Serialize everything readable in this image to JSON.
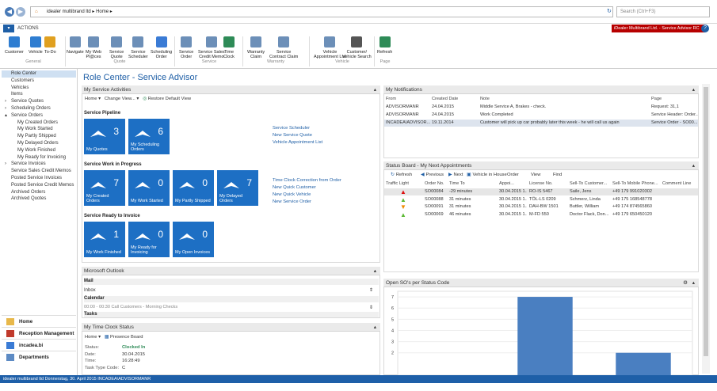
{
  "address": {
    "company": "idealer multibrand ltd",
    "page": "Home",
    "search_placeholder": "Search (Ctrl+F3)"
  },
  "menu": {
    "actions": "ACTIONS",
    "company_banner": "iDealer Multibrand Ltd. - Service Advisor RC"
  },
  "ribbon": {
    "buttons": [
      {
        "label": "Customer"
      },
      {
        "label": "Vehicle"
      },
      {
        "label": "To-Do"
      },
      {
        "label": "Navigate"
      },
      {
        "label": "My Web\nPl@ces"
      },
      {
        "label": "Service\nQuote"
      },
      {
        "label": "Service\nScheduler"
      },
      {
        "label": "Scheduling\nOrder"
      },
      {
        "label": "Service\nOrder"
      },
      {
        "label": "Service Sales\nCredit Memo"
      },
      {
        "label": "Time\nClock"
      },
      {
        "label": "Warranty\nClaim"
      },
      {
        "label": "Service\nContract Claim"
      },
      {
        "label": "Vehicle\nAppointment List"
      },
      {
        "label": "Customer/\nVehicle Search"
      },
      {
        "label": "Refresh"
      }
    ],
    "groups": [
      "General",
      "Quote",
      "Service",
      "Warranty",
      "Vehicle",
      "Page"
    ]
  },
  "sidebar": {
    "items": [
      {
        "label": "Role Center",
        "indent": 0,
        "active": true
      },
      {
        "label": "Customers",
        "indent": 0
      },
      {
        "label": "Vehicles",
        "indent": 0
      },
      {
        "label": "Items",
        "indent": 0
      },
      {
        "label": "Service Quotes",
        "indent": 0,
        "arrow": "›"
      },
      {
        "label": "Scheduling Orders",
        "indent": 0,
        "arrow": "›"
      },
      {
        "label": "Service Orders",
        "indent": 0,
        "arrow": "▴"
      },
      {
        "label": "My Created Orders",
        "indent": 1
      },
      {
        "label": "My Work Started",
        "indent": 1
      },
      {
        "label": "My Partly Shipped",
        "indent": 1
      },
      {
        "label": "My Delayed Orders",
        "indent": 1
      },
      {
        "label": "My Work Finished",
        "indent": 1
      },
      {
        "label": "My Ready for Invoicing",
        "indent": 1
      },
      {
        "label": "Service Invoices",
        "indent": 0,
        "arrow": "›"
      },
      {
        "label": "Service Sales Credit Memos",
        "indent": 0
      },
      {
        "label": "Posted Service Invoices",
        "indent": 0
      },
      {
        "label": "Posted Service Credit Memos",
        "indent": 0
      },
      {
        "label": "Archived Orders",
        "indent": 0
      },
      {
        "label": "Archived Quotes",
        "indent": 0
      }
    ],
    "bottom": [
      "Home",
      "Reception Management",
      "incadea.bi",
      "Departments"
    ]
  },
  "page_title": "Role Center - Service Advisor",
  "activities": {
    "title": "My Service Activities",
    "toolbar": {
      "home": "Home",
      "change_view": "Change View...",
      "restore": "Restore Default View"
    },
    "pipeline": {
      "title": "Service Pipeline",
      "tiles": [
        {
          "num": "3",
          "label": "My Quotes"
        },
        {
          "num": "6",
          "label": "My Scheduling\nOrders"
        }
      ]
    },
    "pipeline_links": [
      "Service Scheduler",
      "New Service Quote",
      "Vehicle Appointment List"
    ],
    "wip": {
      "title": "Service Work in Progress",
      "tiles": [
        {
          "num": "7",
          "label": "My Created\nOrders"
        },
        {
          "num": "0",
          "label": "My Work Started"
        },
        {
          "num": "0",
          "label": "My Partly Shipped"
        },
        {
          "num": "7",
          "label": "My Delayed\nOrders"
        }
      ]
    },
    "wip_links": [
      "Time Clock Correction from Order",
      "New Quick Customer",
      "New Quick Vehicle",
      "New Service Order"
    ],
    "invoice": {
      "title": "Service Ready to Invoice",
      "tiles": [
        {
          "num": "1",
          "label": "My Work Finished"
        },
        {
          "num": "0",
          "label": "My Ready for\nInvoicing"
        },
        {
          "num": "0",
          "label": "My Open Invoices"
        }
      ]
    }
  },
  "outlook": {
    "title": "Microsoft Outlook",
    "mail": "Mail",
    "inbox": "Inbox",
    "calendar": "Calendar",
    "cal_entry": "00:00 - 00:30  Call Customers - Morning Checks",
    "tasks": "Tasks"
  },
  "timeclock": {
    "title": "My Time Clock Status",
    "toolbar": {
      "home": "Home",
      "board": "Presence Board"
    },
    "fields": [
      {
        "label": "Status:",
        "value": "Clocked In"
      },
      {
        "label": "Date:",
        "value": "30.04.2015"
      },
      {
        "label": "Time:",
        "value": "16:28:49"
      },
      {
        "label": "Task Type Code:",
        "value": "C"
      }
    ]
  },
  "notifications": {
    "title": "My Notifications",
    "headers": [
      "From",
      "Created Date",
      "Note",
      "Page"
    ],
    "rows": [
      [
        "ADVISORMANR",
        "24.04.2015",
        "Middle Service A, Brakes - check.",
        "Request: 31,1"
      ],
      [
        "ADVISORMANR",
        "24.04.2015",
        "Work Completed",
        "Service Header: Order..."
      ],
      [
        "INCADEA\\ADVISOR...",
        "19.11.2014",
        "Customer will pick up car probably later this week - he will call us again",
        "Service Order - SO00..."
      ]
    ]
  },
  "status_board": {
    "title": "Status Board - My Next Appointments",
    "toolbar": [
      "Refresh",
      "Previous",
      "Next",
      "Vehicle in House",
      "Order",
      "View",
      "Find"
    ],
    "headers": [
      "Traffic Light",
      "Order No.",
      "Time To",
      "Appoi...",
      "License No.",
      "Sell-To Customer...",
      "Sell-To Mobile Phone...",
      "Comment Line"
    ],
    "rows": [
      {
        "light": "red",
        "cells": [
          "SO00084",
          "-29 minutes",
          "30.04.2015 1...",
          "RO-IS 5467",
          "Saile, Jens",
          "+49 179 991020302",
          ""
        ]
      },
      {
        "light": "green",
        "cells": [
          "SO00088",
          "31 minutes",
          "30.04.2015 1...",
          "TÖL-LS 0209",
          "Schmerz, Linda",
          "+49 175 168548778",
          ""
        ]
      },
      {
        "light": "orange",
        "cells": [
          "SO00091",
          "31 minutes",
          "30.04.2015 1...",
          "DAH-BW 1501",
          "Buttler, William",
          "+49 174 874565860",
          ""
        ]
      },
      {
        "light": "green",
        "cells": [
          "SO00069",
          "46 minutes",
          "30.04.2015 1...",
          "M-FD 550",
          "Doctor Flack, Don...",
          "+49 179 650450120",
          ""
        ]
      }
    ]
  },
  "status_chart": {
    "title": "Open SO's per Status Code"
  },
  "chart_data": {
    "type": "bar",
    "title": "Open SO's per Status Code",
    "categories": [
      "",
      "",
      ""
    ],
    "values": [
      0,
      7,
      2
    ],
    "ylim": [
      0,
      7.5
    ],
    "yticks": [
      "7",
      "6",
      "5",
      "4",
      "3",
      "2"
    ],
    "bar_color": "#4a7fc1"
  },
  "statusbar": {
    "text": "idealer multibrand ltd    Donnerstag, 30. April 2015    INCADEA\\ADVISORMANR"
  },
  "colors": {
    "tile": "#1d6fc4",
    "accent": "#1f5fa6",
    "banner": "#b70000",
    "status": "#1e5fa8"
  }
}
